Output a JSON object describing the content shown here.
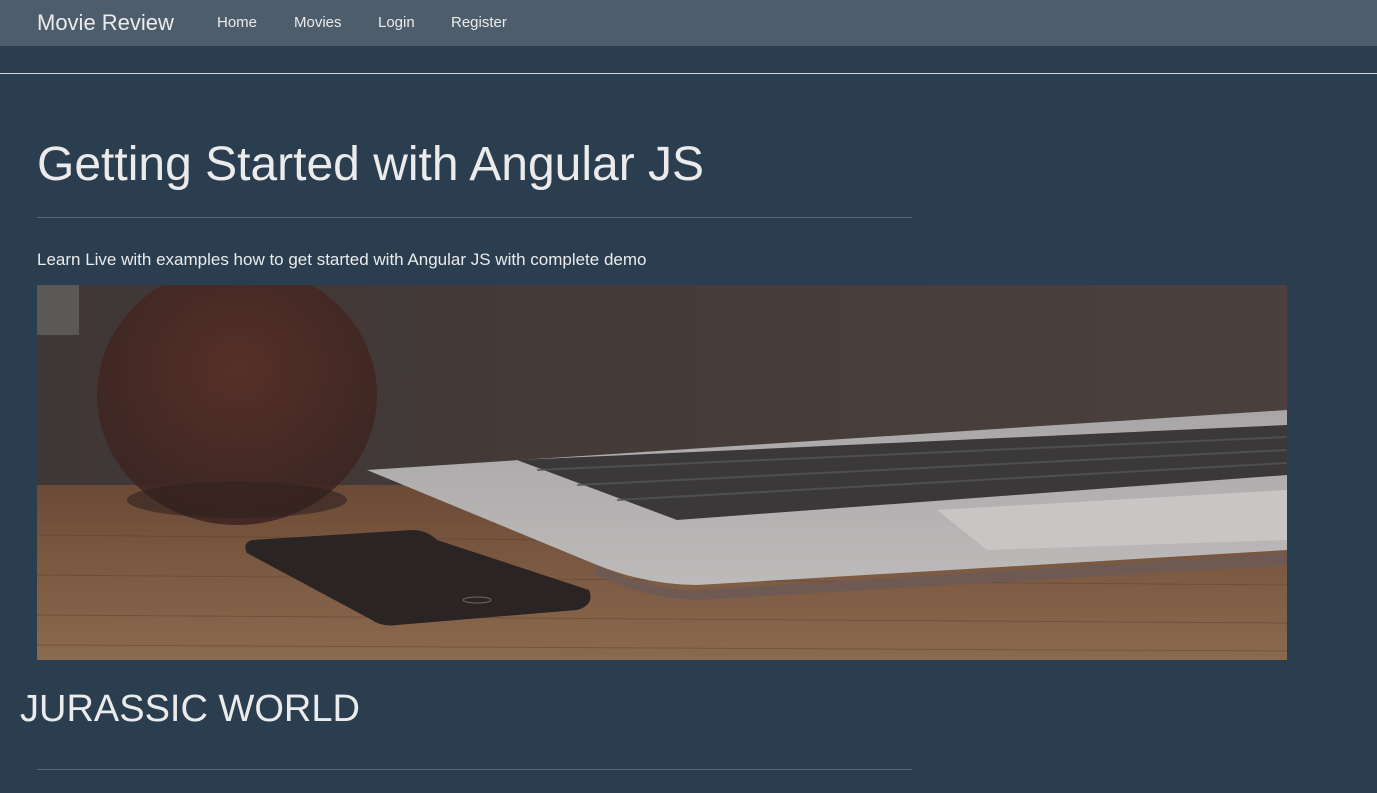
{
  "navbar": {
    "brand": "Movie Review",
    "items": [
      {
        "label": "Home"
      },
      {
        "label": "Movies"
      },
      {
        "label": "Login"
      },
      {
        "label": "Register"
      }
    ]
  },
  "main": {
    "title": "Getting Started with Angular JS",
    "lead": "Learn Live with examples how to get started with Angular JS with complete demo",
    "hero_image": "laptop-and-phone-on-wooden-desk"
  },
  "movie": {
    "title": "JURASSIC WORLD"
  },
  "colors": {
    "background": "#2b3e50",
    "navbar": "#4e5d6c",
    "text": "#ebebeb"
  }
}
